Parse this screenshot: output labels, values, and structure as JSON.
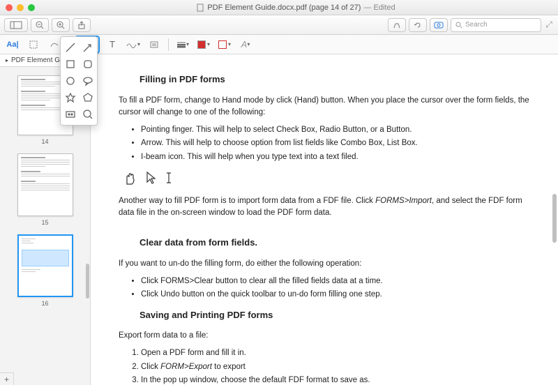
{
  "window": {
    "title": "PDF Element Guide.docx.pdf (page 14 of 27)",
    "edited": "— Edited",
    "search_placeholder": "Search"
  },
  "sidebar": {
    "tab_label": "PDF Element Guide",
    "pages": [
      "14",
      "15",
      "16"
    ]
  },
  "doc": {
    "h1": "Filling in PDF forms",
    "p1": "To fill a PDF form, change to Hand mode by click (Hand) button. When you place the cursor over the form fields, the cursor will change to one of the following:",
    "b1": "Pointing finger. This will help to select Check Box, Radio Button, or a Button.",
    "b2": "Arrow. This will help to choose option from list fields like Combo Box, List Box.",
    "b3": "I-beam icon. This will help when you type text into a text filed.",
    "p2a": "Another way to fill PDF form is to import form data from a FDF file. Click ",
    "p2i": "FORMS>Import",
    "p2b": ", and select the FDF form data file in the on-screen window to load the PDF form data.",
    "h2": "Clear data from form fields.",
    "p3": "If you want to un-do the filling form, do either the following operation:",
    "b4": "Click FORMS>Clear button to clear all the filled fields data at a time.",
    "b5": "Click Undo button on the quick toolbar to un-do form filling one step.",
    "h3": "Saving and Printing PDF forms",
    "p4": "Export form data to a file:",
    "n1": "Open a PDF form and fill it in.",
    "n2a": "Click ",
    "n2i": "FORM>Export",
    "n2b": " to export",
    "n3": "In the pop up window, choose the default FDF format to save as."
  }
}
